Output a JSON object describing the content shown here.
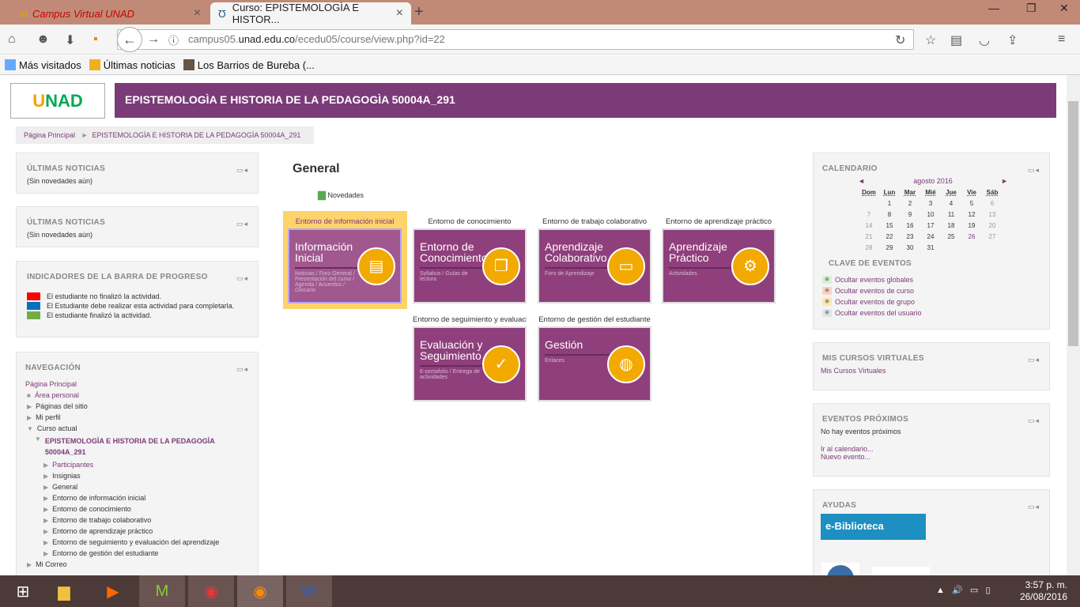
{
  "browser": {
    "tabs": [
      {
        "label": "Campus Virtual UNAD"
      },
      {
        "label": "Curso: EPISTEMOLOGÌA E HISTOR..."
      }
    ],
    "url_pre": "campus05.",
    "url_host": "unad.edu.co",
    "url_path": "/ecedu05/course/view.php?id=22",
    "bookmarks": [
      "Más visitados",
      "Últimas noticias",
      "Los Barrios de Bureba (..."
    ]
  },
  "header": {
    "logo": "UNAD",
    "title": "EPISTEMOLOGÌA E HISTORIA DE LA PEDAGOGÌA 50004A_291"
  },
  "breadcrumb": {
    "home": "Página Principal",
    "sep": "►",
    "course": "EPISTEMOLOGÌA E HISTORIA DE LA PEDAGOGÌA 50004A_291"
  },
  "left": {
    "news1": {
      "title": "ÚLTIMAS NOTICIAS",
      "body": "(Sin novedades aún)"
    },
    "news2": {
      "title": "ÚLTIMAS NOTICIAS",
      "body": "(Sin novedades aún)"
    },
    "progress": {
      "title": "INDICADORES DE LA BARRA DE PROGRESO",
      "items": [
        {
          "color": "#ff0000",
          "text": "El estudiante no finalizó la actividad."
        },
        {
          "color": "#0070c0",
          "text": "El Estudiante debe realizar esta actividad para completarla."
        },
        {
          "color": "#70ad47",
          "text": "El estudiante finalizó la actividad."
        }
      ]
    },
    "nav": {
      "title": "NAVEGACIÓN",
      "home": "Página Principal",
      "area": "Área personal",
      "sitio": "Páginas del sitio",
      "perfil": "Mi perfil",
      "curso": "Curso actual",
      "course": "EPISTEMOLOGÌA E HISTORIA DE LA PEDAGOGÌA 50004A_291",
      "items": [
        "Participantes",
        "Insignias",
        "General",
        "Entorno de información inicial",
        "Entorno de conocimiento",
        "Entorno de trabajo colaborativo",
        "Entorno de aprendizaje práctico",
        "Entorno de seguimiento y evaluación del aprendizaje",
        "Entorno de gestión del estudiante"
      ],
      "more": "Mi Correo"
    }
  },
  "main": {
    "section": "General",
    "news": "Novedades",
    "tiles": [
      {
        "label": "Entorno de información inicial",
        "title": "Información Inicial",
        "sub": "Noticias / Foro General / Presentación del curso / Agenda / Acuerdos / Glosario"
      },
      {
        "label": "Entorno de conocimiento",
        "title": "Entorno de Conocimiento",
        "sub": "Syllabus / Guías de lectura"
      },
      {
        "label": "Entorno de trabajo colaborativo",
        "title": "Aprendizaje Colaborativo",
        "sub": "Foro de Aprendizaje"
      },
      {
        "label": "Entorno de aprendizaje práctico",
        "title": "Aprendizaje Práctico",
        "sub": "Actividades"
      },
      {
        "label": "Entorno de seguimiento y evaluación del aprendizaje",
        "title": "Evaluación y Seguimiento",
        "sub": "E-portafolio / Entrega de actividades"
      },
      {
        "label": "Entorno de gestión del estudiante",
        "title": "Gestión",
        "sub": "Enlaces"
      }
    ]
  },
  "right": {
    "calendar": {
      "title": "CALENDARIO",
      "month": "agosto 2016",
      "prev": "◄",
      "next": "►",
      "days": [
        "Dom",
        "Lun",
        "Mar",
        "Mié",
        "Jue",
        "Vie",
        "Sáb"
      ],
      "weeks": [
        [
          "",
          "1",
          "2",
          "3",
          "4",
          "5",
          "6"
        ],
        [
          "7",
          "8",
          "9",
          "10",
          "11",
          "12",
          "13"
        ],
        [
          "14",
          "15",
          "16",
          "17",
          "18",
          "19",
          "20"
        ],
        [
          "21",
          "22",
          "23",
          "24",
          "25",
          "26",
          "27"
        ],
        [
          "28",
          "29",
          "30",
          "31",
          "",
          "",
          ""
        ]
      ],
      "key_title": "CLAVE DE EVENTOS",
      "keys": [
        {
          "text": "Ocultar eventos globales",
          "color": "#d7f2d0"
        },
        {
          "text": "Ocultar eventos de curso",
          "color": "#ffd3bd"
        },
        {
          "text": "Ocultar eventos de grupo",
          "color": "#fee7ae"
        },
        {
          "text": "Ocultar eventos del usuario",
          "color": "#dce7ec"
        }
      ]
    },
    "courses": {
      "title": "MIS CURSOS VIRTUALES",
      "link": "Mis Cursos Virtuales"
    },
    "upcoming": {
      "title": "EVENTOS PRÓXIMOS",
      "body": "No hay eventos próximos",
      "cal": "Ir al calendario...",
      "new": "Nuevo evento..."
    },
    "help": {
      "title": "AYUDAS",
      "biblio": "e-Biblioteca"
    }
  },
  "taskbar": {
    "time": "3:57 p. m.",
    "date": "26/08/2016"
  }
}
